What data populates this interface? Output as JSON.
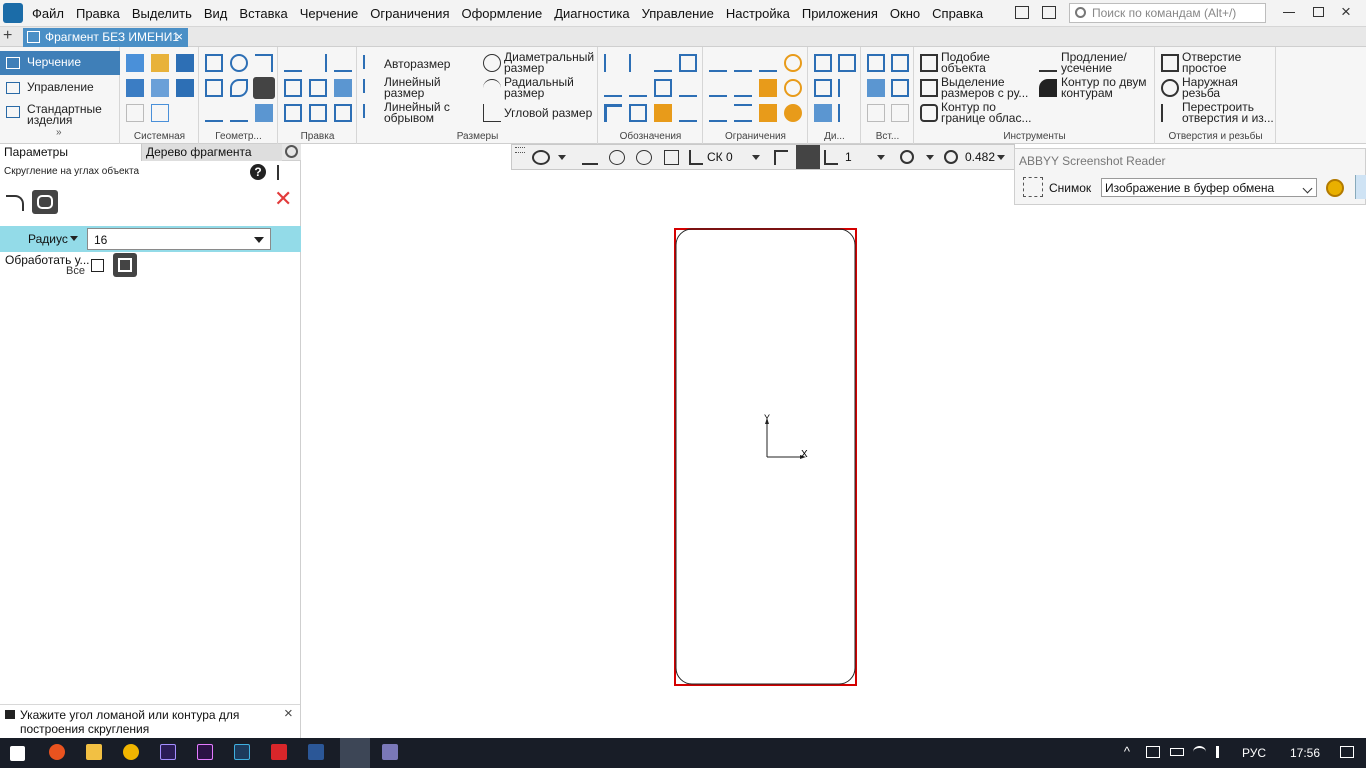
{
  "app": {
    "menu": [
      "Файл",
      "Правка",
      "Выделить",
      "Вид",
      "Вставка",
      "Черчение",
      "Ограничения",
      "Оформление",
      "Диагностика",
      "Управление",
      "Настройка",
      "Приложения",
      "Окно",
      "Справка"
    ],
    "search_placeholder": "Поиск по командам (Alt+/)"
  },
  "tab": {
    "title": "Фрагмент БЕЗ ИМЕНИ1",
    "close": "×",
    "add": "+"
  },
  "modes": [
    {
      "label": "Черчение",
      "active": true
    },
    {
      "label": "Управление",
      "active": false
    },
    {
      "label": "Стандартные изделия",
      "active": false
    }
  ],
  "ribbon": {
    "groups": [
      "Системная",
      "Геометр...",
      "Правка",
      "Размеры",
      "Обозначения",
      "Ограничения",
      "Ди...",
      "Вст...",
      "Инструменты",
      "Отверстия и резьбы"
    ],
    "sizes": {
      "auto": "Авторазмер",
      "linear": "Линейный размер",
      "linear_break": "Линейный с обрывом",
      "diameter": "Диаметральный размер",
      "radial": "Радиальный размер",
      "angle": "Угловой размер"
    },
    "tools": {
      "similar": "Подобие объекта",
      "select_dims": "Выделение размеров с ру...",
      "contour_region": "Контур по границе облас...",
      "extend": "Продление/ усечение",
      "contour_two": "Контур по двум контурам"
    },
    "holes": {
      "simple": "Отверстие простое",
      "thread": "Наружная резьба",
      "rebuild": "Перестроить отверстия и из..."
    }
  },
  "panel": {
    "tab_params": "Параметры",
    "tab_tree": "Дерево фрагмента",
    "subtitle": "Скругление на углах объекта",
    "radius_label": "Радиус",
    "radius_value": "16",
    "process_label": "Обработать у...",
    "process_all": "Все",
    "hint": "Укажите угол ломаной или контура для построения скругления"
  },
  "viewbar": {
    "cs": "СК 0",
    "layer": "1",
    "zoom": "0.482"
  },
  "abbyy": {
    "title": "ABBYY Screenshot Reader",
    "snap_label": "Снимок",
    "option": "Изображение в буфер обмена"
  },
  "drawing": {
    "axis_x": "X",
    "axis_y": "Y",
    "accent": "#d40000"
  },
  "taskbar": {
    "lang": "РУС",
    "time": "17:56"
  }
}
